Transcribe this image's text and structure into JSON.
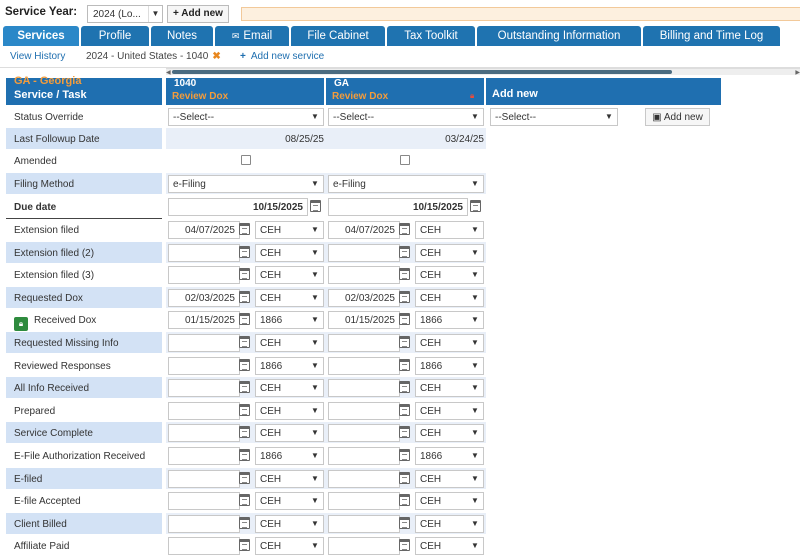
{
  "topbar": {
    "service_year_label": "Service Year:",
    "year_value": "2024 (Lo...",
    "add_new_label": "+ Add new"
  },
  "tabs": [
    {
      "label": "Services",
      "active": true
    },
    {
      "label": "Profile"
    },
    {
      "label": "Notes"
    },
    {
      "label": "Email",
      "icon": "envelope-icon"
    },
    {
      "label": "File Cabinet"
    },
    {
      "label": "Tax Toolkit"
    },
    {
      "label": "Outstanding Information"
    },
    {
      "label": "Billing and Time Log"
    }
  ],
  "subbar": {
    "view_history": "View History",
    "current_service": "2024 - United States - 1040",
    "close_symbol": "✖",
    "add_service": "Add new service",
    "add_service_icon": "+"
  },
  "header": {
    "state": "GA - Georgia",
    "service_task": "Service / Task",
    "columns": [
      {
        "title": "1040",
        "status": "Review Dox",
        "locked": false
      },
      {
        "title": "GA",
        "status": "Review Dox",
        "locked": true
      }
    ],
    "add_new": "Add new"
  },
  "status_override": {
    "label": "Status Override",
    "col1": "--Select--",
    "col2": "--Select--",
    "add_select": "--Select--",
    "add_button": "Add new"
  },
  "last_followup": {
    "label": "Last Followup Date",
    "col1": "08/25/25",
    "col2": "03/24/25"
  },
  "amended": {
    "label": "Amended"
  },
  "filing_method": {
    "label": "Filing Method",
    "col1": "e-Filing",
    "col2": "e-Filing"
  },
  "due_date": {
    "label": "Due date",
    "col1": "10/15/2025",
    "col2": "10/15/2025"
  },
  "tasks": [
    {
      "label": "Extension filed",
      "d1": "04/07/2025",
      "u1": "CEH",
      "d2": "04/07/2025",
      "u2": "CEH"
    },
    {
      "label": "Extension filed (2)",
      "d1": "",
      "u1": "CEH",
      "d2": "",
      "u2": "CEH"
    },
    {
      "label": "Extension filed (3)",
      "d1": "",
      "u1": "CEH",
      "d2": "",
      "u2": "CEH"
    },
    {
      "label": "Requested Dox",
      "d1": "02/03/2025",
      "u1": "CEH",
      "d2": "02/03/2025",
      "u2": "CEH"
    },
    {
      "label": "Received Dox",
      "d1": "01/15/2025",
      "u1": "1866",
      "d2": "01/15/2025",
      "u2": "1866",
      "locked": true
    },
    {
      "label": "Requested Missing Info",
      "d1": "",
      "u1": "CEH",
      "d2": "",
      "u2": "CEH"
    },
    {
      "label": "Reviewed Responses",
      "d1": "",
      "u1": "1866",
      "d2": "",
      "u2": "1866"
    },
    {
      "label": "All Info Received",
      "d1": "",
      "u1": "CEH",
      "d2": "",
      "u2": "CEH"
    },
    {
      "label": "Prepared",
      "d1": "",
      "u1": "CEH",
      "d2": "",
      "u2": "CEH"
    },
    {
      "label": "Service Complete",
      "d1": "",
      "u1": "CEH",
      "d2": "",
      "u2": "CEH"
    },
    {
      "label": "E-File Authorization Received",
      "d1": "",
      "u1": "1866",
      "d2": "",
      "u2": "1866"
    },
    {
      "label": "E-filed",
      "d1": "",
      "u1": "CEH",
      "d2": "",
      "u2": "CEH"
    },
    {
      "label": "E-file Accepted",
      "d1": "",
      "u1": "CEH",
      "d2": "",
      "u2": "CEH"
    },
    {
      "label": "Client Billed",
      "d1": "",
      "u1": "CEH",
      "d2": "",
      "u2": "CEH"
    },
    {
      "label": "Affiliate Paid",
      "d1": "",
      "u1": "CEH",
      "d2": "",
      "u2": "CEH"
    }
  ],
  "colors": {
    "tab_blue": "#1f73b0",
    "accent_orange": "#f39c3c",
    "row_shade": "#d3e2f5"
  }
}
